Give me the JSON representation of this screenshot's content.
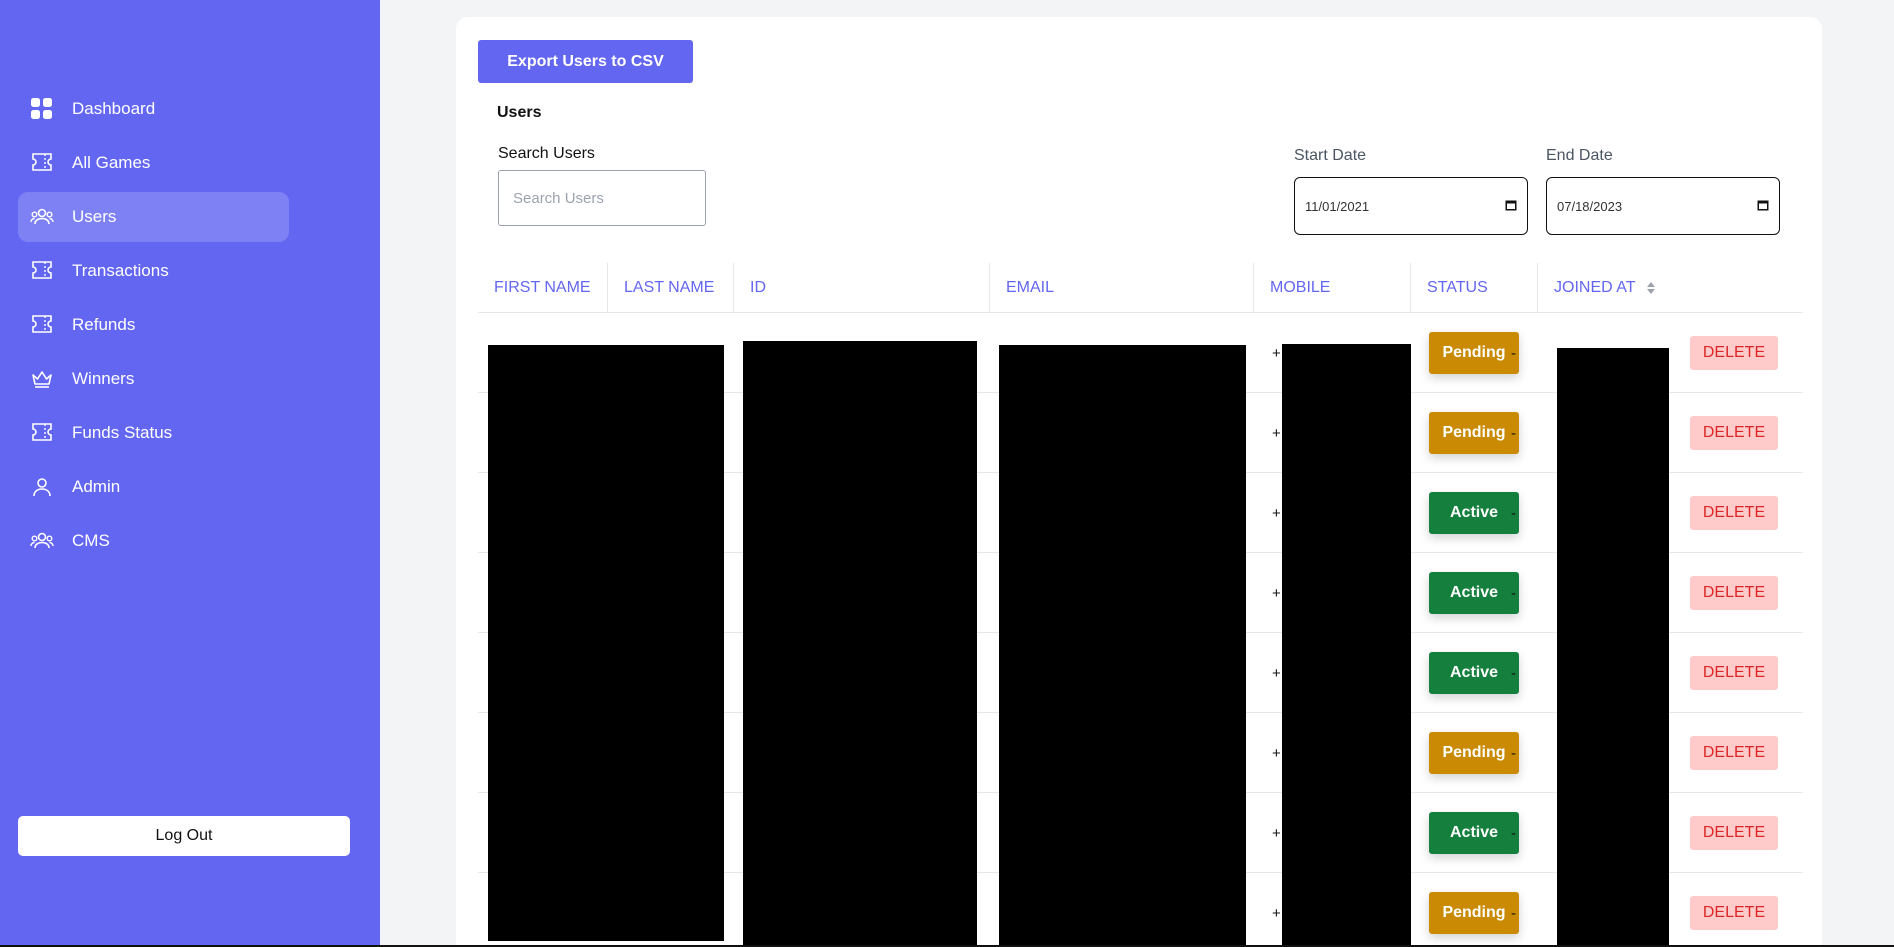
{
  "sidebar": {
    "items": [
      {
        "label": "Dashboard",
        "icon": "grid-icon"
      },
      {
        "label": "All Games",
        "icon": "ticket-icon"
      },
      {
        "label": "Users",
        "icon": "users-icon",
        "active": true
      },
      {
        "label": "Transactions",
        "icon": "ticket-icon"
      },
      {
        "label": "Refunds",
        "icon": "ticket-icon"
      },
      {
        "label": "Winners",
        "icon": "crown-icon"
      },
      {
        "label": "Funds Status",
        "icon": "ticket-icon"
      },
      {
        "label": "Admin",
        "icon": "user-icon"
      },
      {
        "label": "CMS",
        "icon": "users-icon"
      }
    ],
    "logout_label": "Log Out"
  },
  "main": {
    "export_label": "Export Users to CSV",
    "title": "Users",
    "search": {
      "label": "Search Users",
      "placeholder": "Search Users"
    },
    "start_date": {
      "label": "Start Date",
      "value": "11/01/2021"
    },
    "end_date": {
      "label": "End Date",
      "value": "07/18/2023"
    }
  },
  "table": {
    "headers": [
      "FIRST NAME",
      "LAST NAME",
      "ID",
      "EMAIL",
      "MOBILE",
      "STATUS",
      "JOINED AT"
    ],
    "rows": [
      {
        "mobile": "+",
        "status": "Pending",
        "joined": "-",
        "action": "DELETE"
      },
      {
        "mobile": "+",
        "status": "Pending",
        "joined": "-",
        "action": "DELETE"
      },
      {
        "mobile": "+",
        "status": "Active",
        "joined": "-",
        "action": "DELETE"
      },
      {
        "mobile": "+",
        "status": "Active",
        "joined": "-",
        "action": "DELETE"
      },
      {
        "mobile": "+",
        "status": "Active",
        "joined": "-",
        "action": "DELETE"
      },
      {
        "mobile": "+",
        "status": "Pending",
        "joined": "-",
        "action": "DELETE"
      },
      {
        "mobile": "+",
        "status": "Active",
        "joined": "-",
        "action": "DELETE"
      },
      {
        "mobile": "+",
        "status": "Pending",
        "joined": "-",
        "action": "DELETE"
      }
    ]
  },
  "colors": {
    "brand": "#6366f1",
    "pending": "#ca8a04",
    "active": "#15803d",
    "delete_bg": "#fecaca",
    "delete_text": "#dc2626"
  }
}
